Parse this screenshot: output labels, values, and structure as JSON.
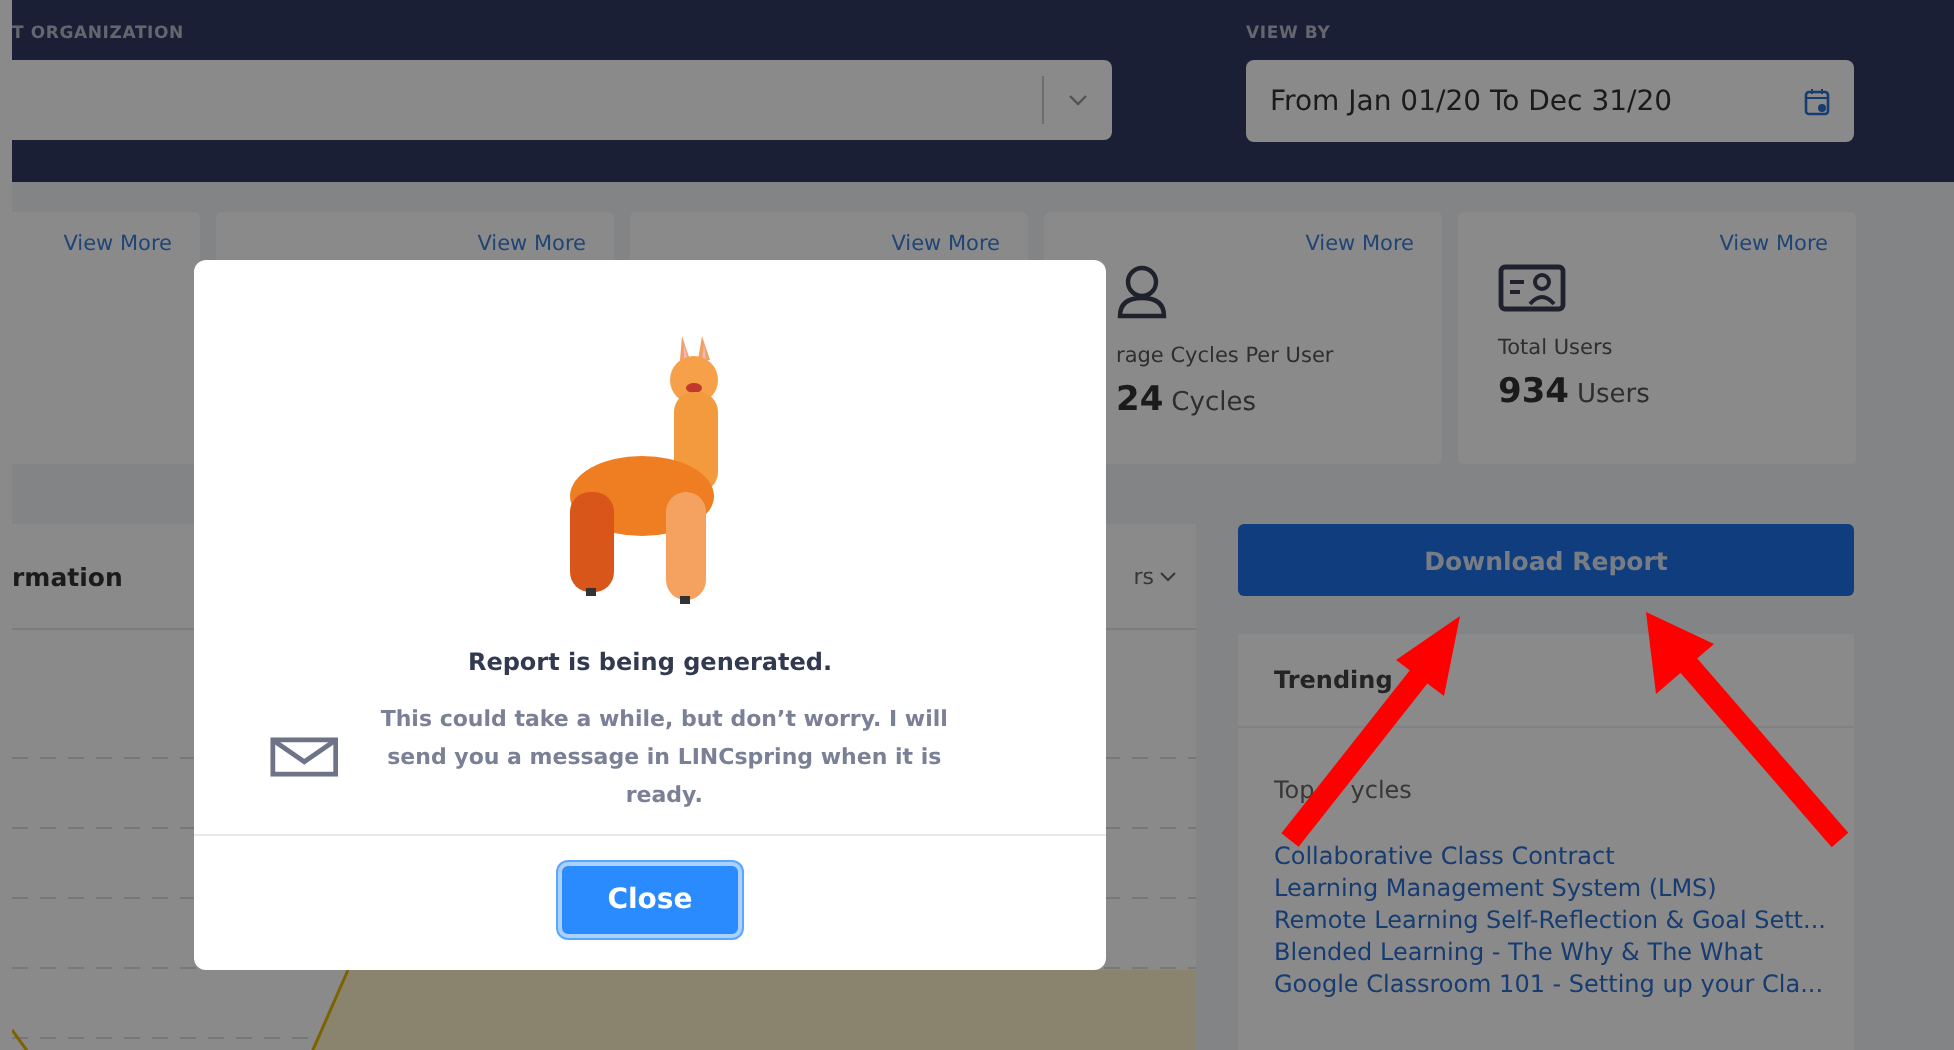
{
  "header": {
    "organization_label": "T ORGANIZATION",
    "view_by_label": "VIEW BY",
    "date_range": "From Jan 01/20 To Dec 31/20"
  },
  "cards": [
    {
      "link": "View More"
    },
    {
      "link": "View More"
    },
    {
      "link": "View More"
    },
    {
      "link": "View More",
      "label": "rage Cycles Per User",
      "value": "24",
      "unit": "Cycles"
    },
    {
      "link": "View More",
      "label": "Total Users",
      "value": "934",
      "unit": "Users"
    }
  ],
  "panel": {
    "title": "rmation",
    "filter": "rs"
  },
  "download_button": "Download Report",
  "trending": {
    "title": "Trending",
    "subtitle": [
      "Top",
      "ycles"
    ],
    "links": [
      "Collaborative Class Contract",
      "Learning Management System (LMS)",
      "Remote Learning Self-Reflection & Goal Sett...",
      "Blended Learning - The Why & The What",
      "Google Classroom 101 - Setting up your Cla..."
    ]
  },
  "modal": {
    "title": "Report is being generated.",
    "message": "This could take a while, but don’t worry. I will send you a message in LINCspring when it is ready.",
    "button": "Close"
  }
}
